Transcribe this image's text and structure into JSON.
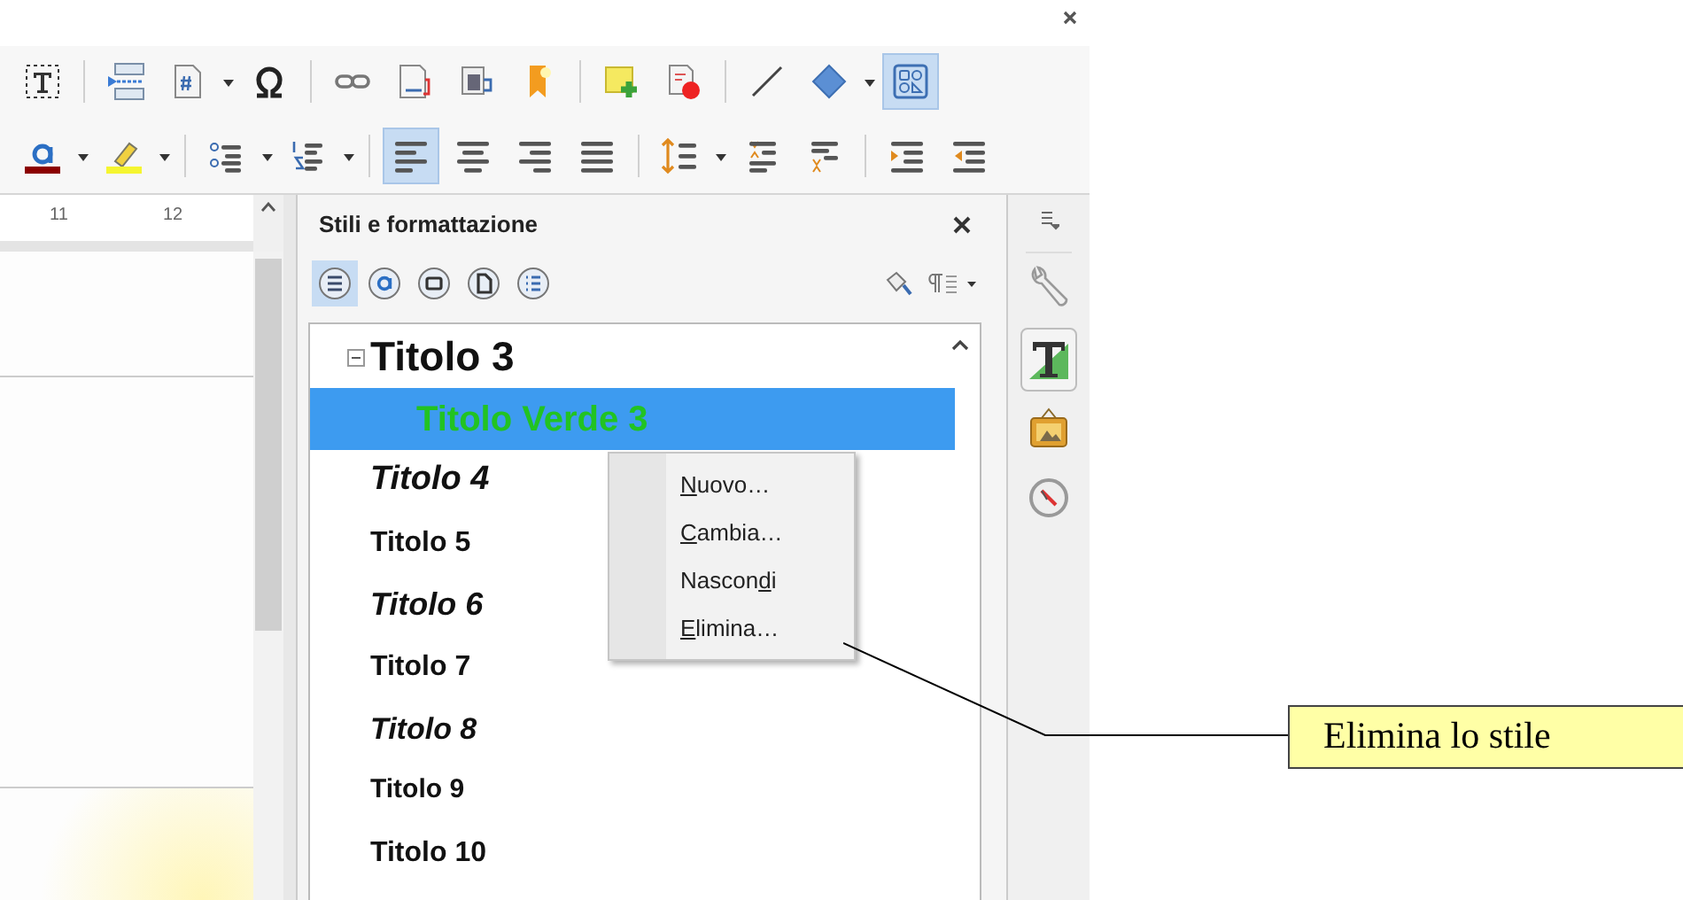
{
  "toolbar_rows": [
    [
      {
        "kind": "text-box",
        "selected": false
      },
      {
        "kind": "sep"
      },
      {
        "kind": "field",
        "selected": false
      },
      {
        "kind": "page-number",
        "selected": false
      },
      {
        "kind": "caret"
      },
      {
        "kind": "special-char",
        "selected": false
      },
      {
        "kind": "sep"
      },
      {
        "kind": "hyperlink",
        "selected": false
      },
      {
        "kind": "footnote",
        "selected": false
      },
      {
        "kind": "endnote",
        "selected": false
      },
      {
        "kind": "bookmark",
        "selected": false
      },
      {
        "kind": "sep"
      },
      {
        "kind": "comment",
        "selected": false
      },
      {
        "kind": "track-changes",
        "selected": false
      },
      {
        "kind": "sep"
      },
      {
        "kind": "line",
        "selected": false
      },
      {
        "kind": "diamond",
        "selected": false
      },
      {
        "kind": "caret"
      },
      {
        "kind": "shapes",
        "selected": true
      }
    ],
    [
      {
        "kind": "font-color",
        "selected": false
      },
      {
        "kind": "caret"
      },
      {
        "kind": "highlighter",
        "selected": false
      },
      {
        "kind": "caret"
      },
      {
        "kind": "sep"
      },
      {
        "kind": "bullets",
        "selected": false
      },
      {
        "kind": "caret"
      },
      {
        "kind": "numbering",
        "selected": false
      },
      {
        "kind": "caret"
      },
      {
        "kind": "sep"
      },
      {
        "kind": "align-left",
        "selected": true
      },
      {
        "kind": "align-center",
        "selected": false
      },
      {
        "kind": "align-right",
        "selected": false
      },
      {
        "kind": "justify",
        "selected": false
      },
      {
        "kind": "sep"
      },
      {
        "kind": "line-spacing",
        "selected": false
      },
      {
        "kind": "caret"
      },
      {
        "kind": "space-above",
        "selected": false
      },
      {
        "kind": "space-below",
        "selected": false
      },
      {
        "kind": "sep"
      },
      {
        "kind": "indent-more",
        "selected": false
      },
      {
        "kind": "indent-less",
        "selected": false
      }
    ]
  ],
  "ruler": {
    "ticks": [
      "11",
      "12"
    ]
  },
  "styles_panel": {
    "title": "Stili e formattazione",
    "categories": [
      {
        "kind": "paragraph",
        "selected": true
      },
      {
        "kind": "character",
        "selected": false
      },
      {
        "kind": "frame",
        "selected": false
      },
      {
        "kind": "page",
        "selected": false
      },
      {
        "kind": "list",
        "selected": false
      }
    ],
    "styles": [
      {
        "name": "Titolo 3",
        "kind": "regular",
        "selected": false,
        "expanded": true,
        "children": [
          {
            "name": "Titolo Verde 3",
            "kind": "regular",
            "selected": true,
            "color": "#22c322"
          }
        ]
      },
      {
        "name": "Titolo 4",
        "kind": "italic",
        "selected": false
      },
      {
        "name": "Titolo 5",
        "kind": "regular",
        "selected": false
      },
      {
        "name": "Titolo 6",
        "kind": "italic",
        "selected": false
      },
      {
        "name": "Titolo 7",
        "kind": "regular",
        "selected": false
      },
      {
        "name": "Titolo 8",
        "kind": "italic",
        "selected": false
      },
      {
        "name": "Titolo 9",
        "kind": "regular",
        "selected": false
      },
      {
        "name": "Titolo 10",
        "kind": "regular",
        "selected": false
      }
    ]
  },
  "context_menu": [
    {
      "accel": "N",
      "after": "uovo…"
    },
    {
      "accel": "C",
      "after": "ambia…"
    },
    {
      "before": "Nascon",
      "accel": "d",
      "after": "i"
    },
    {
      "accel": "E",
      "after": "limina…"
    }
  ],
  "deck": [
    {
      "kind": "properties",
      "selected": false
    },
    {
      "kind": "styles",
      "selected": true
    },
    {
      "kind": "gallery",
      "selected": false
    },
    {
      "kind": "navigator",
      "selected": false
    }
  ],
  "callout": {
    "text": "Elimina lo stile"
  }
}
